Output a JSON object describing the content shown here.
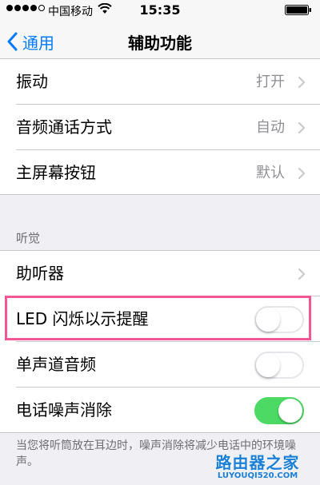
{
  "status_bar": {
    "carrier": "中国移动",
    "time": "15:35"
  },
  "nav": {
    "back_label": "通用",
    "title": "辅助功能"
  },
  "group1": {
    "rows": [
      {
        "label": "振动",
        "value": "打开"
      },
      {
        "label": "音频通话方式",
        "value": "自动"
      },
      {
        "label": "主屏幕按钮",
        "value": "默认"
      }
    ]
  },
  "hearing": {
    "section_header": "听觉",
    "rows": [
      {
        "label": "助听器",
        "kind": "chevron"
      },
      {
        "label": "LED 闪烁以示提醒",
        "kind": "toggle",
        "on": false
      },
      {
        "label": "单声道音频",
        "kind": "toggle",
        "on": false
      },
      {
        "label": "电话噪声消除",
        "kind": "toggle",
        "on": true
      }
    ]
  },
  "footer_note": "当您将听筒放在耳边时，噪声消除将减少电话中的环境噪声。",
  "watermark": {
    "title": "路由器之家",
    "url": "LUYOUQI520.COM"
  },
  "colors": {
    "accent": "#007aff",
    "toggle_on": "#4cd964",
    "highlight": "#f25694",
    "watermark": "#1a7fd6"
  }
}
